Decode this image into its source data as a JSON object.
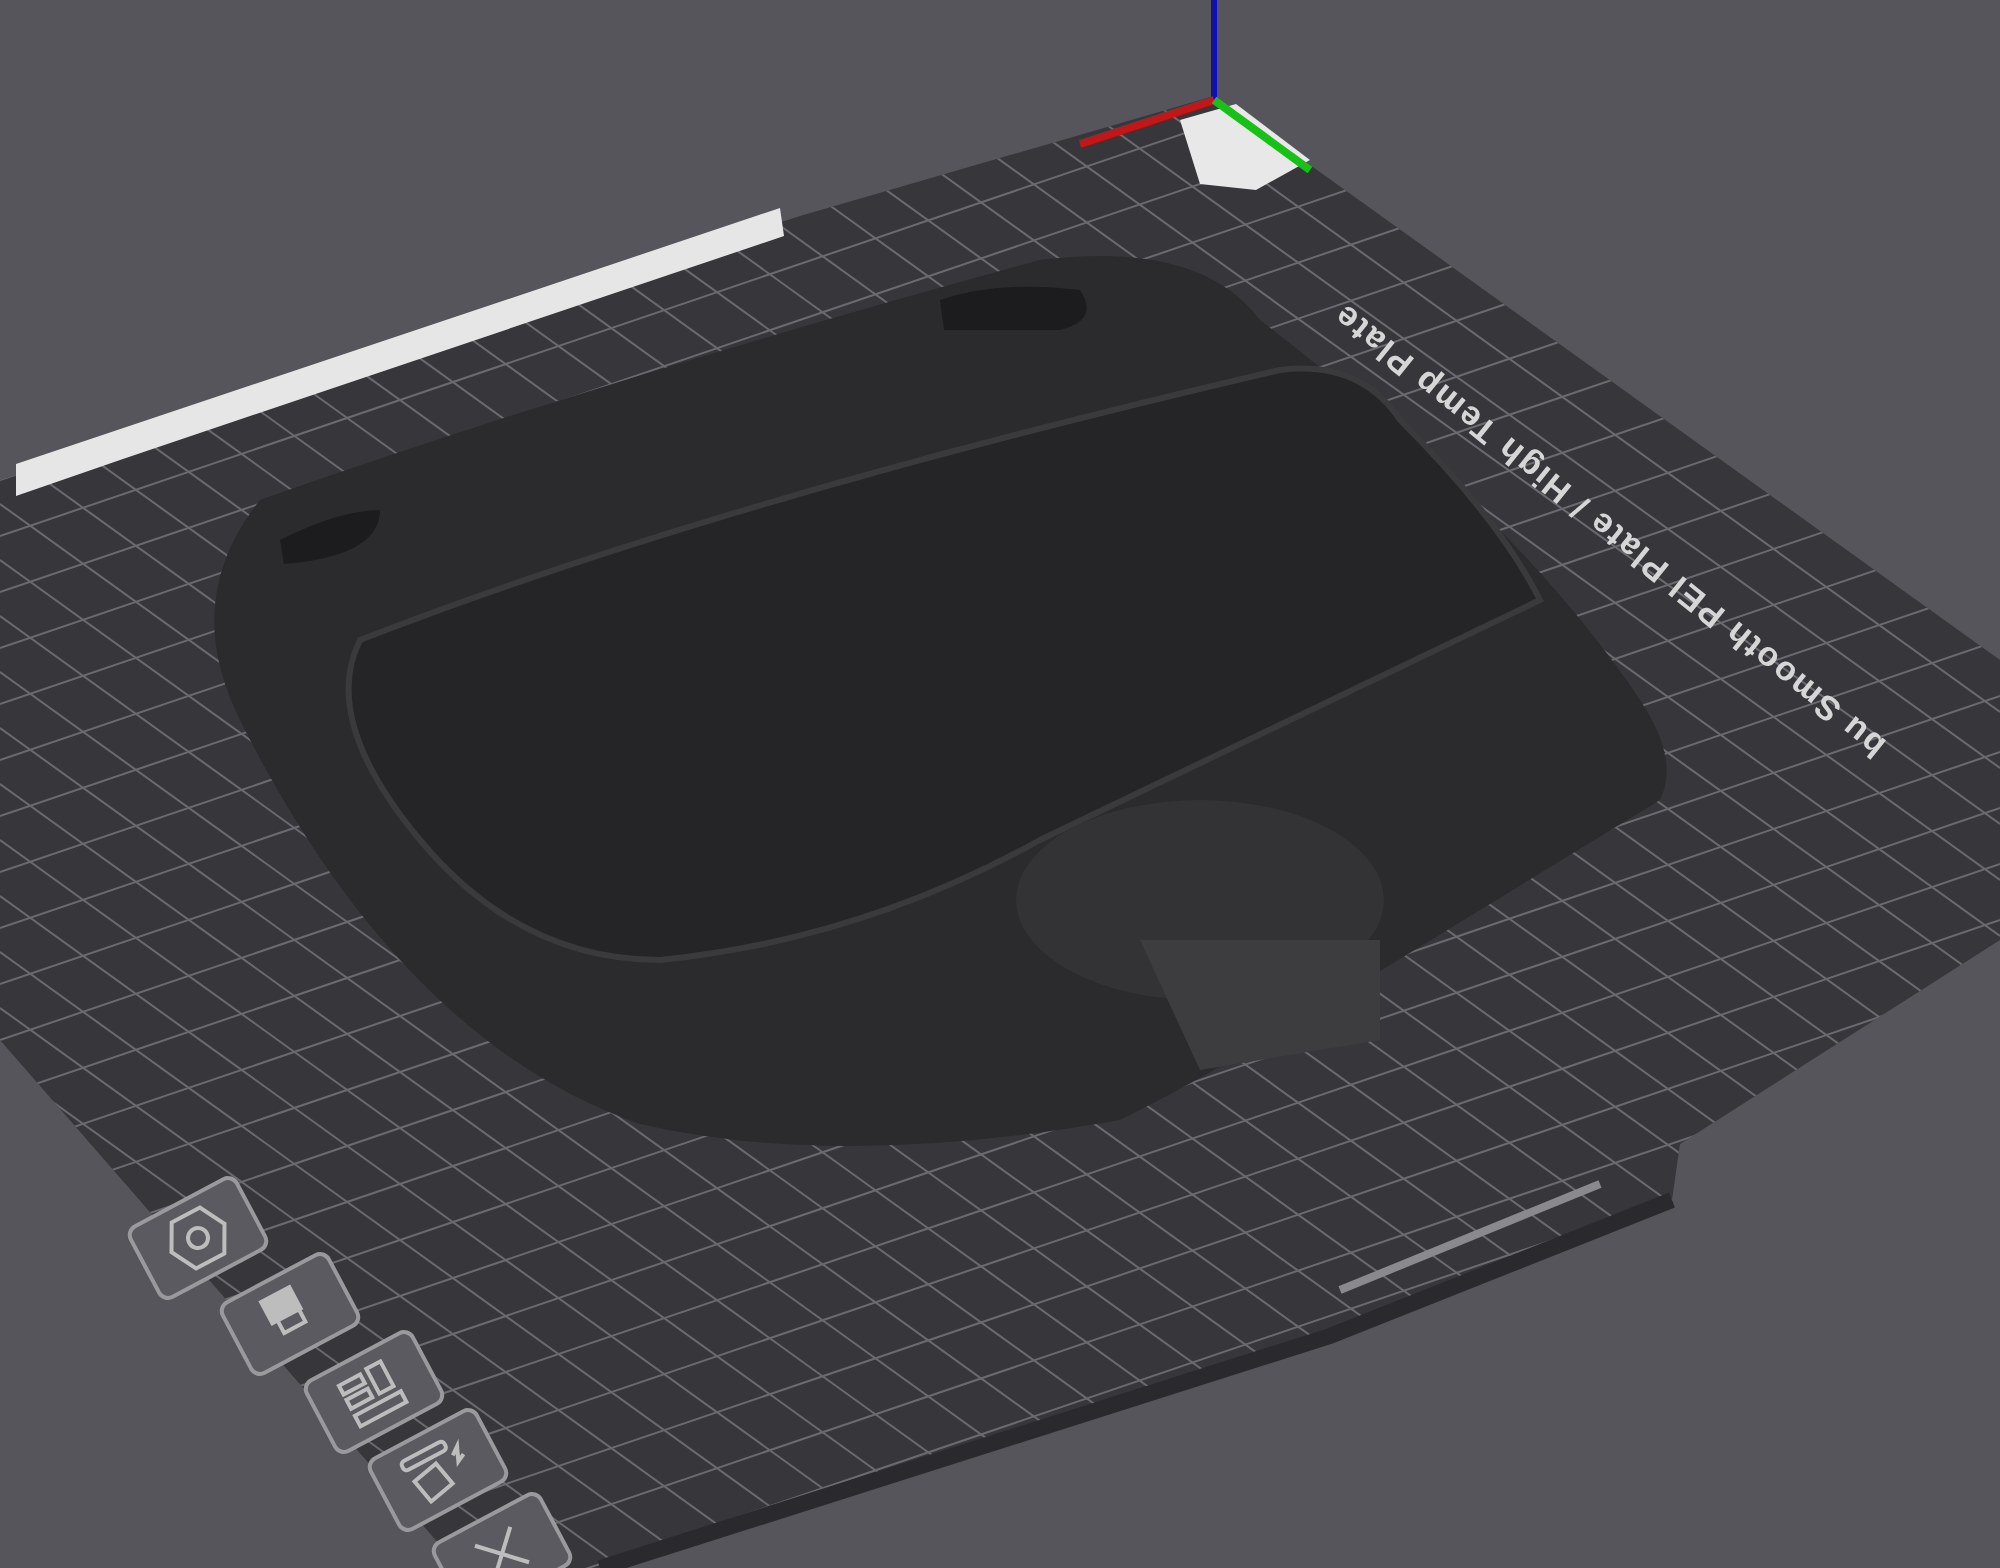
{
  "viewport": {
    "plate_label": "bu Smooth PEI Plate / High Temp Plate"
  },
  "plate_toolbar": [
    {
      "kind": "orient"
    },
    {
      "kind": "filament"
    },
    {
      "kind": "arrange"
    },
    {
      "kind": "auto"
    },
    {
      "kind": "close"
    }
  ]
}
